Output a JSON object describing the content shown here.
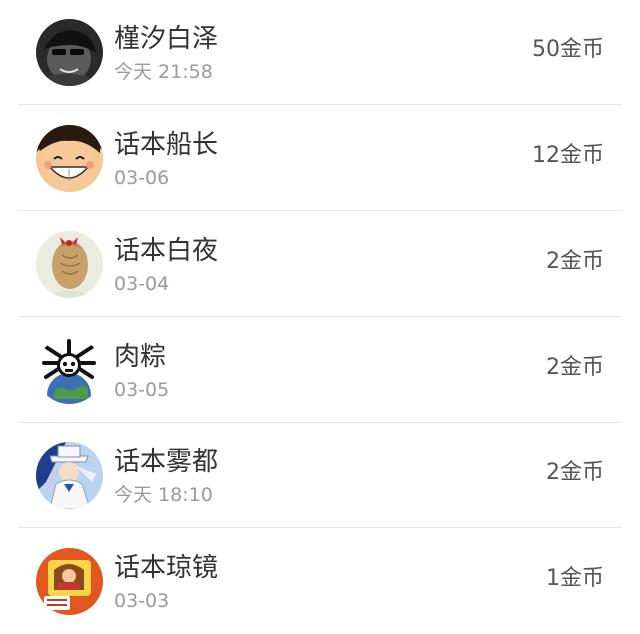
{
  "list": {
    "items": [
      {
        "name": "槿汐白泽",
        "time": "今天 21:58",
        "coins": "50金币",
        "avatar_icon": "dark-sunglasses-avatar"
      },
      {
        "name": "话本船长",
        "time": "03-06",
        "coins": "12金币",
        "avatar_icon": "smiling-pirate-avatar"
      },
      {
        "name": "话本白夜",
        "time": "03-04",
        "coins": "2金币",
        "avatar_icon": "hair-bow-avatar"
      },
      {
        "name": "肉粽",
        "time": "03-05",
        "coins": "2金币",
        "avatar_icon": "skull-crossbones-globe-avatar"
      },
      {
        "name": "话本雾都",
        "time": "今天 18:10",
        "coins": "2金币",
        "avatar_icon": "white-suit-thief-avatar"
      },
      {
        "name": "话本琼镜",
        "time": "03-03",
        "coins": "1金币",
        "avatar_icon": "orange-badge-avatar"
      }
    ]
  }
}
